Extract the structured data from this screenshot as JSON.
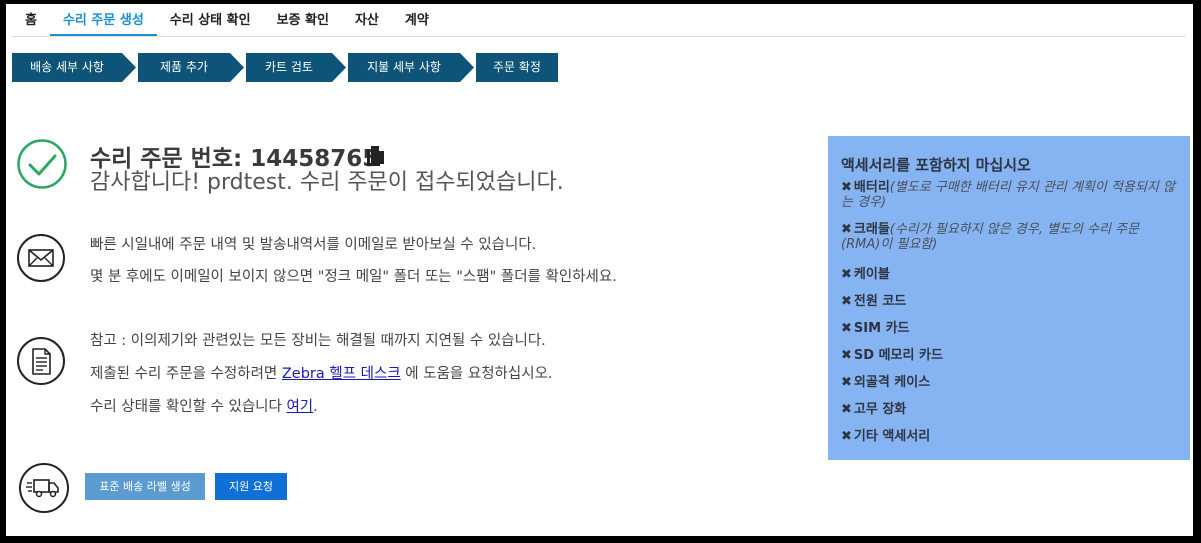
{
  "nav": {
    "tabs": [
      {
        "label": "홈"
      },
      {
        "label": "수리 주문 생성"
      },
      {
        "label": "수리 상태 확인"
      },
      {
        "label": "보증 확인"
      },
      {
        "label": "자산"
      },
      {
        "label": "계약"
      }
    ],
    "active_index": 1
  },
  "steps": [
    {
      "label": "배송 세부 사항"
    },
    {
      "label": "제품 추가"
    },
    {
      "label": "카트 검토"
    },
    {
      "label": "지불 세부 사항"
    },
    {
      "label": "주문 확정"
    }
  ],
  "confirmation": {
    "order_label": "수리 주문 번호:",
    "order_number": "14458765",
    "thanks": "감사합니다! prdtest. 수리 주문이 접수되었습니다."
  },
  "email_info": {
    "line1": "빠른 시일내에 주문 내역 및 발송내역서를 이메일로 받아보실 수 있습니다.",
    "line2": "몇 분 후에도 이메일이 보이지 않으면 \"정크 메일\" 폴더 또는 \"스팸\" 폴더를 확인하세요."
  },
  "notes": {
    "line1": "참고 : 이의제기와 관련있는 모든 장비는 해결될 때까지 지연될 수 있습니다.",
    "line2_prefix": "제출된 수리 주문을 수정하려면 ",
    "line2_link": "Zebra 헬프 데스크",
    "line2_suffix": " 에 도움을 요청하십시오.",
    "line3_prefix": "수리 상태를 확인할 수 있습니다 ",
    "line3_link": "여기",
    "line3_suffix": "."
  },
  "buttons": {
    "shipping_label": "표준 배송 라벨 생성",
    "support": "지원 요청"
  },
  "accessories": {
    "title": "액세서리를 포함하지 마십시오",
    "items": [
      {
        "name": "배터리",
        "note": "(별도로 구매한 배터리 유지 관리 계획이 적용되지 않는 경우)"
      },
      {
        "name": "크래들",
        "note": "(수리가 필요하지 않은 경우, 별도의 수리 주문(RMA)이 필요함)"
      },
      {
        "name": "케이블",
        "note": ""
      },
      {
        "name": "전원 코드",
        "note": ""
      },
      {
        "name": "SIM 카드",
        "note": ""
      },
      {
        "name": "SD 메모리 카드",
        "note": ""
      },
      {
        "name": "외골격 케이스",
        "note": ""
      },
      {
        "name": "고무 장화",
        "note": ""
      },
      {
        "name": "기타 액세서리",
        "note": ""
      }
    ]
  },
  "colors": {
    "accent": "#1a8fd4",
    "step_bg": "#0e5479",
    "success": "#2aa860",
    "panel_bg": "#86b3f2"
  }
}
